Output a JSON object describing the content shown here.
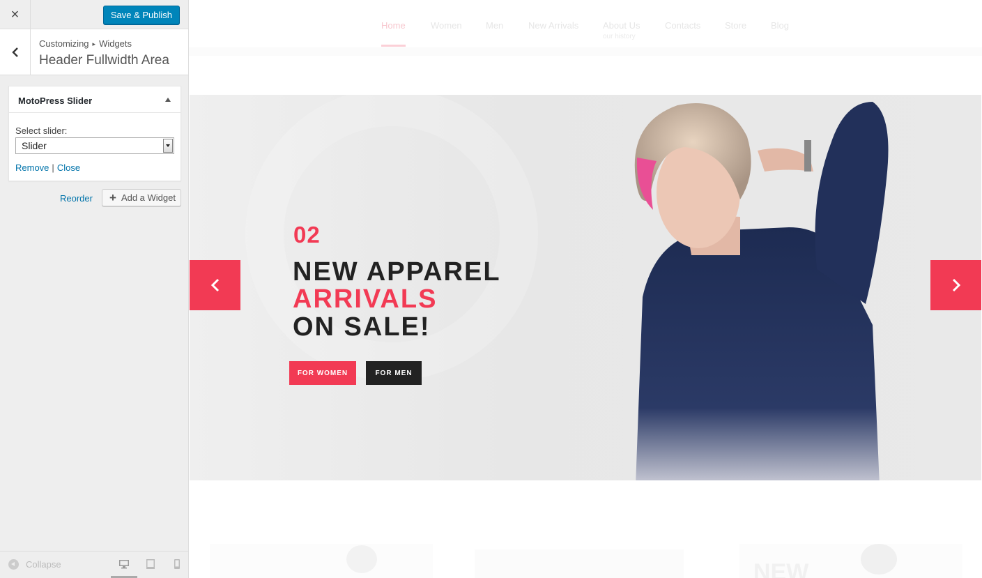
{
  "sidebar": {
    "close_label": "×",
    "publish_label": "Save & Publish",
    "breadcrumb": {
      "part1": "Customizing",
      "separator": "▸",
      "part2": "Widgets"
    },
    "section_title": "Header Fullwidth Area",
    "widget": {
      "title": "MotoPress Slider",
      "select_label": "Select slider:",
      "select_value": "Slider",
      "remove_label": "Remove",
      "divider": "|",
      "close_label": "Close"
    },
    "reorder_label": "Reorder",
    "add_widget_label": "Add a Widget",
    "collapse_label": "Collapse"
  },
  "preview": {
    "nav": {
      "items": [
        "Home",
        "Women",
        "Men",
        "New Arrivals",
        "About Us",
        "Contacts",
        "Store",
        "Blog"
      ],
      "about_sub": "our history"
    },
    "slide": {
      "number": "02",
      "line1": "NEW APPAREL",
      "line2": "ARRIVALS",
      "line3": "ON SALE!",
      "btn_women": "FOR WOMEN",
      "btn_men": "FOR MEN"
    },
    "below_text": "NEW"
  },
  "colors": {
    "accent": "#f23a54",
    "publish_blue": "#0085ba",
    "link_blue": "#0073aa",
    "dark": "#222222"
  },
  "icons": {
    "close": "close-icon",
    "back": "chevron-left-icon",
    "toggle": "triangle-up-icon",
    "add": "plus-icon",
    "collapse": "collapse-icon",
    "desktop": "desktop-icon",
    "tablet": "tablet-icon",
    "mobile": "mobile-icon",
    "prev": "chevron-left-icon",
    "next": "chevron-right-icon"
  }
}
